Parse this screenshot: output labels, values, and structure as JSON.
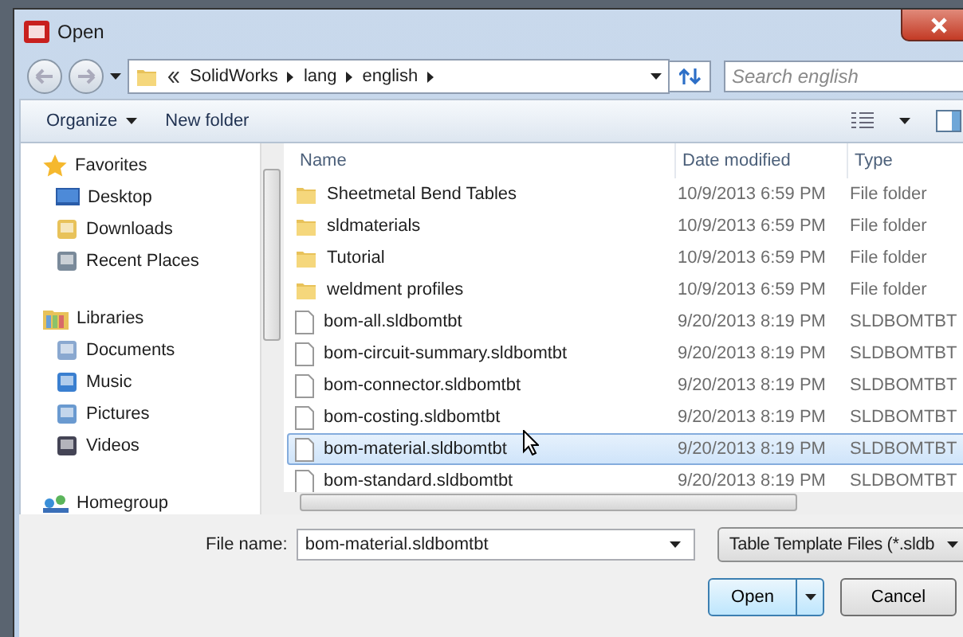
{
  "window": {
    "title": "Open"
  },
  "address": {
    "path": [
      "SolidWorks",
      "lang",
      "english"
    ]
  },
  "search": {
    "placeholder": "Search english"
  },
  "toolbar": {
    "organize": "Organize",
    "new_folder": "New folder"
  },
  "nav": [
    {
      "label": "Favorites",
      "children": [
        {
          "label": "Desktop"
        },
        {
          "label": "Downloads"
        },
        {
          "label": "Recent Places"
        }
      ]
    },
    {
      "label": "Libraries",
      "children": [
        {
          "label": "Documents"
        },
        {
          "label": "Music"
        },
        {
          "label": "Pictures"
        },
        {
          "label": "Videos"
        }
      ]
    },
    {
      "label": "Homegroup"
    }
  ],
  "columns": [
    "Name",
    "Date modified",
    "Type"
  ],
  "rows": [
    {
      "name": "Sheetmetal Bend Tables",
      "date": "10/9/2013 6:59 PM",
      "type": "File folder",
      "kind": "folder",
      "selected": false
    },
    {
      "name": "sldmaterials",
      "date": "10/9/2013 6:59 PM",
      "type": "File folder",
      "kind": "folder",
      "selected": false
    },
    {
      "name": "Tutorial",
      "date": "10/9/2013 6:59 PM",
      "type": "File folder",
      "kind": "folder",
      "selected": false
    },
    {
      "name": "weldment profiles",
      "date": "10/9/2013 6:59 PM",
      "type": "File folder",
      "kind": "folder",
      "selected": false
    },
    {
      "name": "bom-all.sldbomtbt",
      "date": "9/20/2013 8:19 PM",
      "type": "SLDBOMTBT",
      "kind": "file",
      "selected": false
    },
    {
      "name": "bom-circuit-summary.sldbomtbt",
      "date": "9/20/2013 8:19 PM",
      "type": "SLDBOMTBT",
      "kind": "file",
      "selected": false
    },
    {
      "name": "bom-connector.sldbomtbt",
      "date": "9/20/2013 8:19 PM",
      "type": "SLDBOMTBT",
      "kind": "file",
      "selected": false
    },
    {
      "name": "bom-costing.sldbomtbt",
      "date": "9/20/2013 8:19 PM",
      "type": "SLDBOMTBT",
      "kind": "file",
      "selected": false
    },
    {
      "name": "bom-material.sldbomtbt",
      "date": "9/20/2013 8:19 PM",
      "type": "SLDBOMTBT",
      "kind": "file",
      "selected": true
    },
    {
      "name": "bom-standard.sldbomtbt",
      "date": "9/20/2013 8:19 PM",
      "type": "SLDBOMTBT",
      "kind": "file",
      "selected": false
    }
  ],
  "file_name": {
    "label": "File name:",
    "value": "bom-material.sldbomtbt"
  },
  "file_type": {
    "value": "Table Template Files (*.sldb"
  },
  "buttons": {
    "open": "Open",
    "cancel": "Cancel"
  }
}
